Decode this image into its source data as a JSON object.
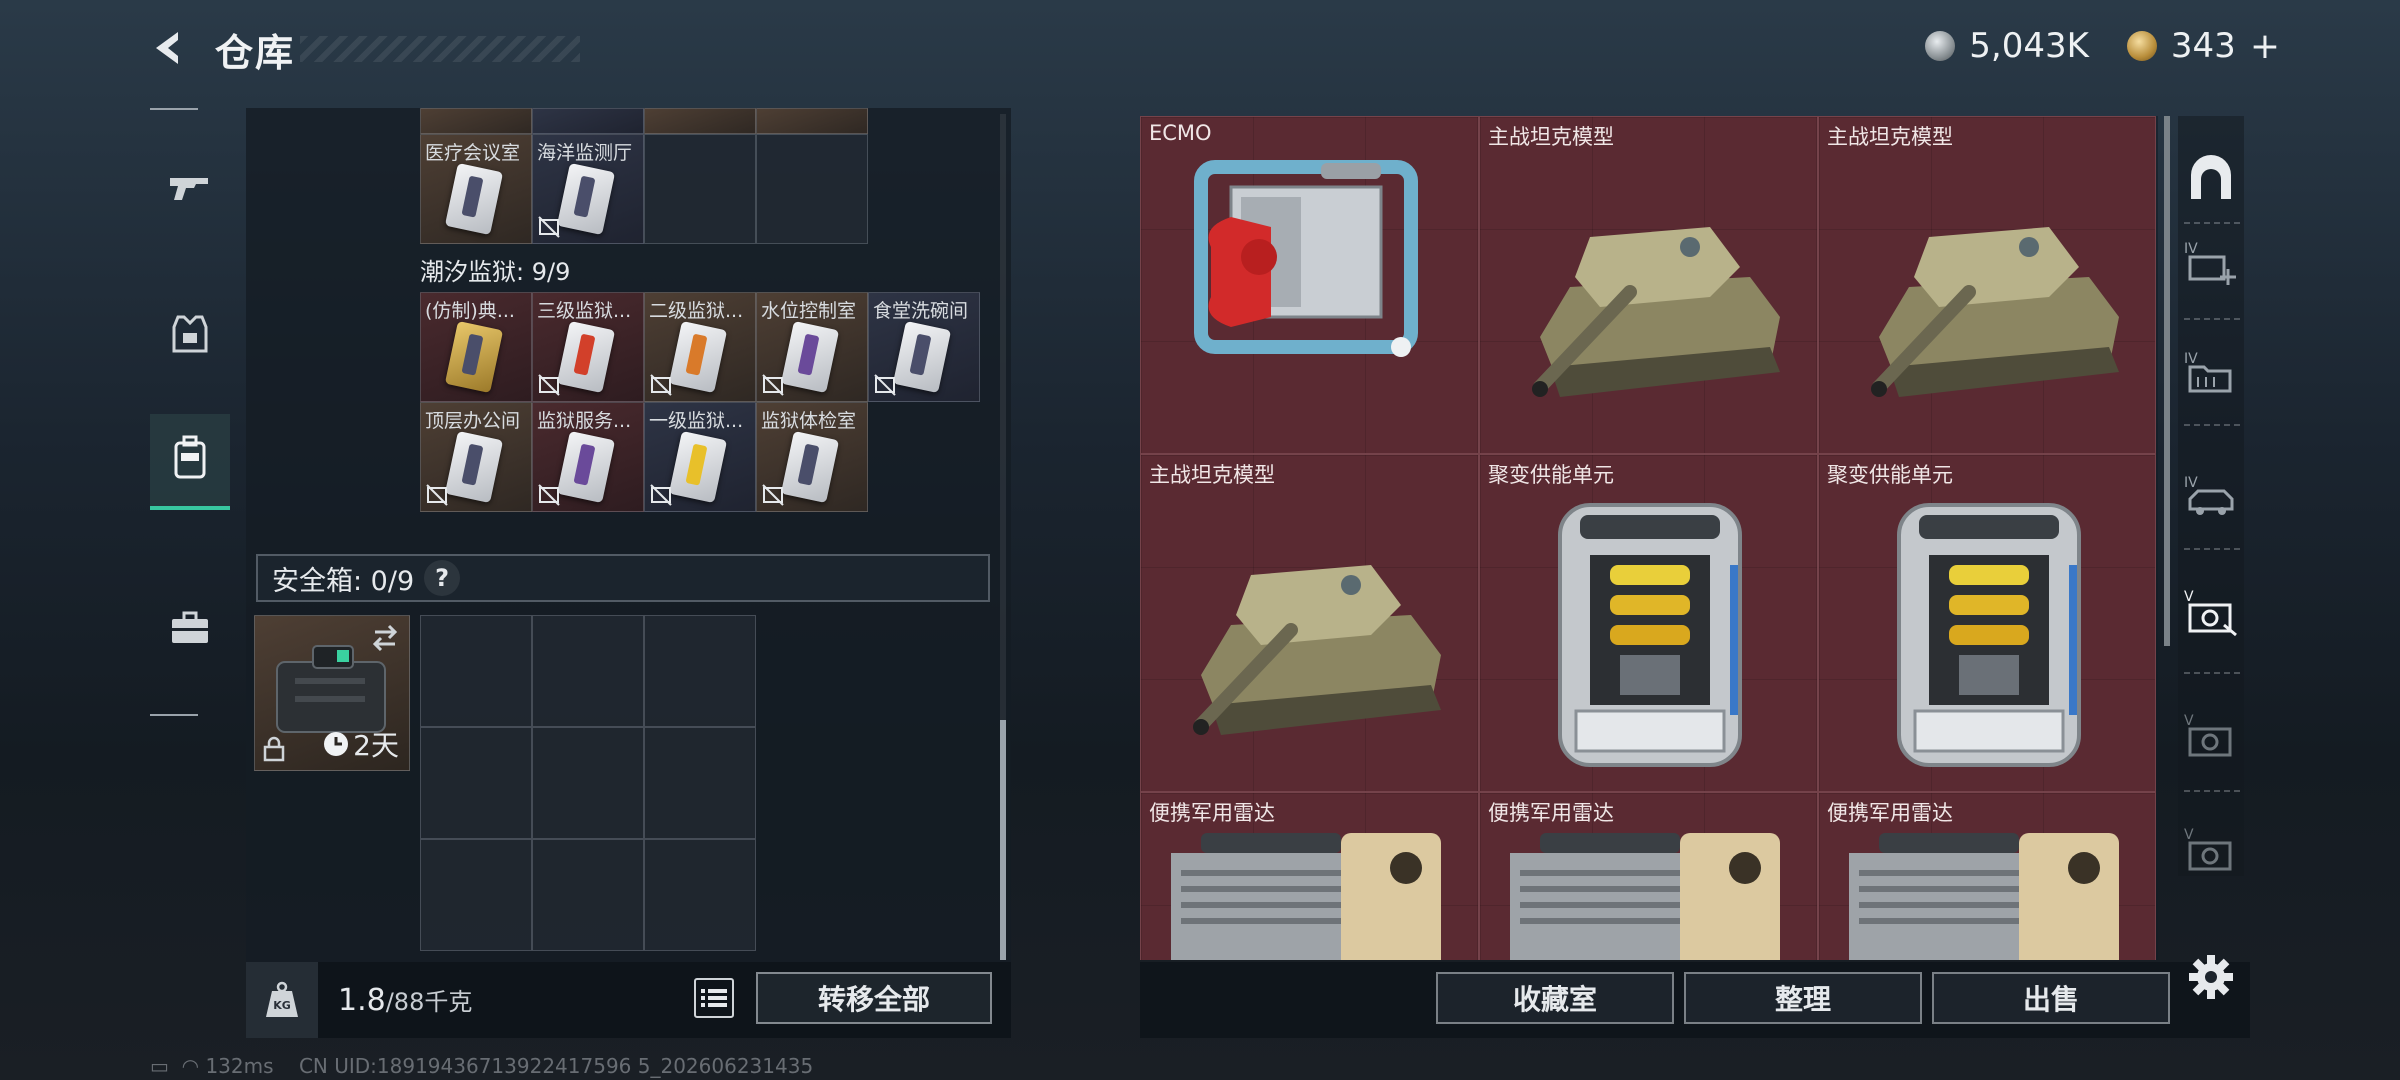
{
  "header": {
    "title": "仓库",
    "currency_silver": "5,043K",
    "currency_gold": "343",
    "plus": "+"
  },
  "left_nav": [
    {
      "name": "weapons",
      "icon": "gun-icon"
    },
    {
      "name": "armor",
      "icon": "vest-icon"
    },
    {
      "name": "backpack",
      "icon": "backpack-icon",
      "active": true
    },
    {
      "name": "case",
      "icon": "briefcase-icon"
    }
  ],
  "top_group": {
    "items": [
      {
        "label": "医疗会议室",
        "color": "brown"
      },
      {
        "label": "海洋监测厅",
        "color": "blue"
      }
    ]
  },
  "prison_group": {
    "title": "潮汐监狱: 9/9",
    "row1": [
      {
        "label": "(仿制)典...",
        "color": "red"
      },
      {
        "label": "三级监狱...",
        "color": "red"
      },
      {
        "label": "二级监狱...",
        "color": "brown"
      },
      {
        "label": "水位控制室",
        "color": "brown"
      },
      {
        "label": "食堂洗碗间",
        "color": "blue"
      }
    ],
    "row2": [
      {
        "label": "顶层办公间",
        "color": "brown"
      },
      {
        "label": "监狱服务...",
        "color": "red"
      },
      {
        "label": "一级监狱...",
        "color": "blue"
      },
      {
        "label": "监狱体检室",
        "color": "brown"
      }
    ]
  },
  "safebox": {
    "label": "安全箱: 0/9",
    "help": "?",
    "timer": "2天"
  },
  "bottom_left": {
    "weight_current": "1.8",
    "weight_total": "/88千克",
    "transfer_all": "转移全部"
  },
  "stash": {
    "items": [
      {
        "label": "ECMO",
        "type": "ecmo"
      },
      {
        "label": "主战坦克模型",
        "type": "tank"
      },
      {
        "label": "主战坦克模型",
        "type": "tank"
      },
      {
        "label": "主战坦克模型",
        "type": "tank"
      },
      {
        "label": "聚变供能单元",
        "type": "fusion"
      },
      {
        "label": "聚变供能单元",
        "type": "fusion"
      },
      {
        "label": "便携军用雷达",
        "type": "radar"
      },
      {
        "label": "便携军用雷达",
        "type": "radar"
      },
      {
        "label": "便携军用雷达",
        "type": "radar"
      }
    ]
  },
  "bottom_right": {
    "collection": "收藏室",
    "organize": "整理",
    "sell": "出售"
  },
  "right_nav": [
    {
      "name": "stash-main",
      "icon": "archway-icon"
    },
    {
      "name": "stash-iv-add",
      "icon": "stash-add-icon"
    },
    {
      "name": "stash-iv-folder",
      "icon": "folder-icon"
    },
    {
      "name": "stash-iv-car",
      "icon": "vehicle-icon"
    },
    {
      "name": "stash-v-camera",
      "icon": "camera-icon"
    },
    {
      "name": "stash-v-camera-2",
      "icon": "camera-icon"
    },
    {
      "name": "stash-v-camera-3",
      "icon": "camera-icon"
    }
  ],
  "footer": {
    "ping": "132ms",
    "uid": "CN UID:18919436713922417596 5_202606231435"
  }
}
